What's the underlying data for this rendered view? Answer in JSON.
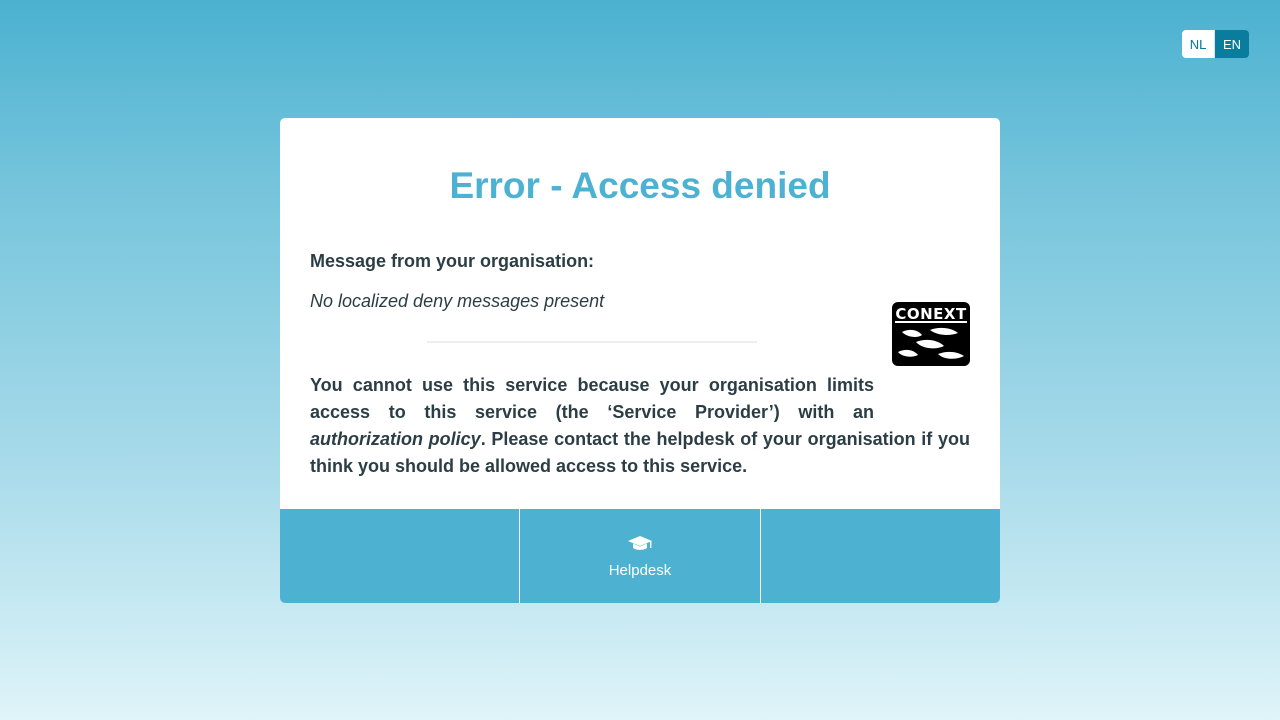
{
  "lang": {
    "nl": "NL",
    "en": "EN",
    "active": "EN"
  },
  "card": {
    "title": "Error - Access denied",
    "message_heading": "Message from your organisation:",
    "message_text": "No localized deny messages present",
    "logo_text": "CONEXT",
    "body_part1": "You cannot use this service because your organisation limits access to this service (the ‘Service Provider’) with an ",
    "body_emphasis": "authorization policy",
    "body_part2": ". Please contact the helpdesk of your organisation if you think you should be allowed access to this service."
  },
  "footer": {
    "helpdesk_label": "Helpdesk",
    "helpdesk_icon": "graduation-cap-icon"
  }
}
